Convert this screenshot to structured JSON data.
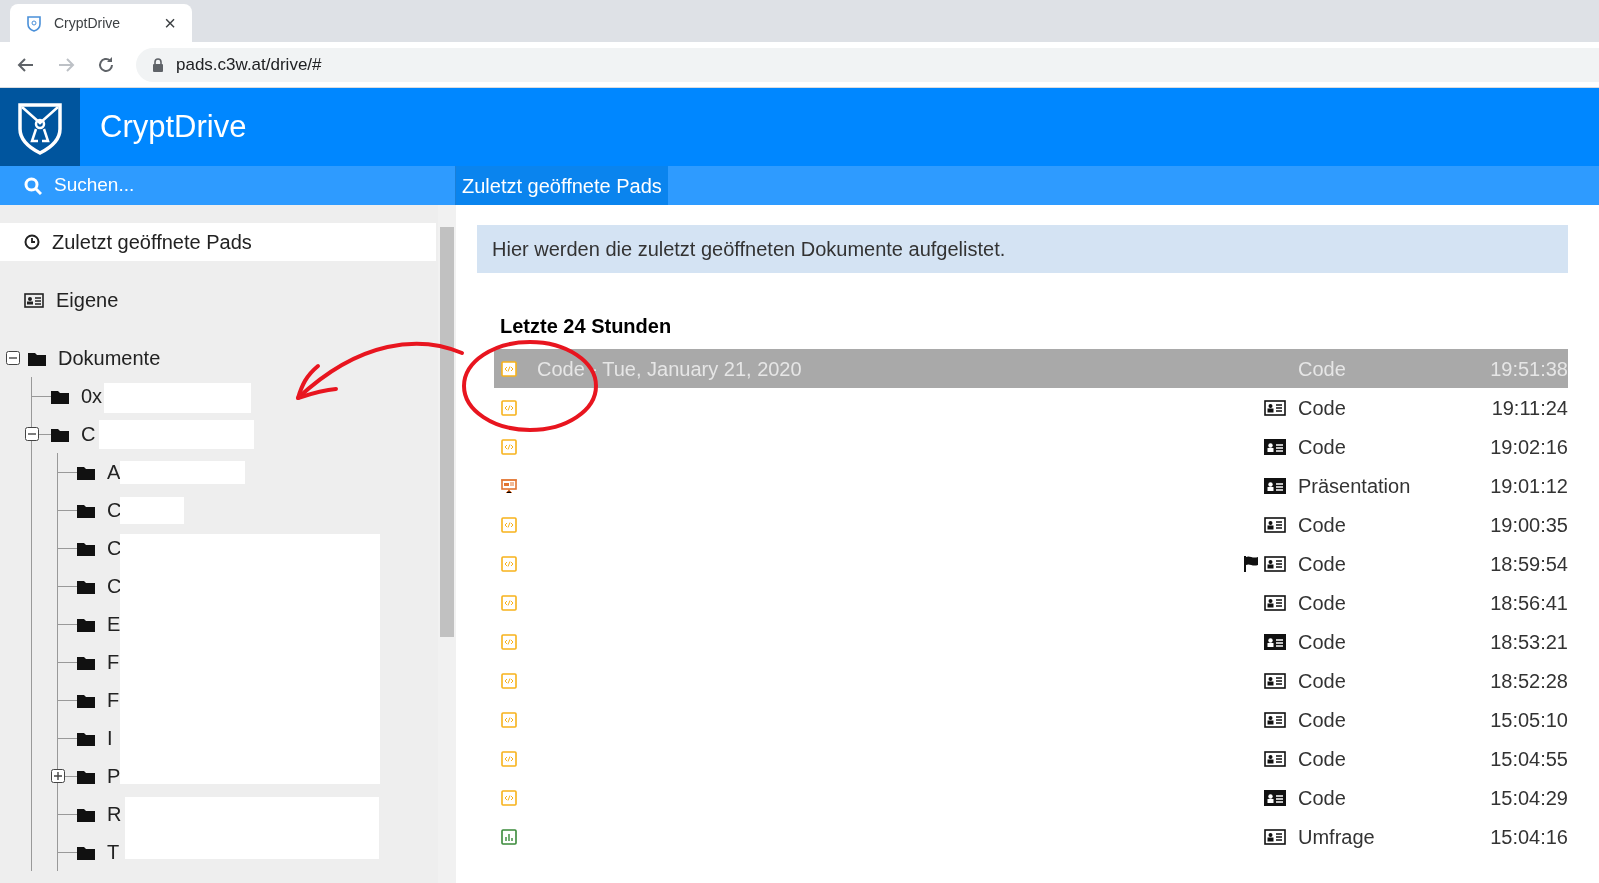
{
  "browser": {
    "tab_title": "CryptDrive",
    "tab_close": "×",
    "url": "pads.c3w.at/drive/#"
  },
  "app": {
    "title": "CryptDrive"
  },
  "search": {
    "placeholder": "Suchen..."
  },
  "view_tab": {
    "label": "Zuletzt geöffnete Pads",
    "selected": true
  },
  "sidebar": {
    "items": [
      {
        "label": "Zuletzt geöffnete Pads",
        "kind": "recent",
        "selected": true
      },
      {
        "label": "Eigene",
        "kind": "owned",
        "selected": false
      }
    ],
    "tree": {
      "name": "Dokumente",
      "expanded": true,
      "children": [
        {
          "name": "0x"
        },
        {
          "name": "C",
          "expanded": true,
          "children": [
            {
              "name": "A"
            },
            {
              "name": "C"
            },
            {
              "name": "C"
            },
            {
              "name": "C"
            },
            {
              "name": "E"
            },
            {
              "name": "F"
            },
            {
              "name": "F"
            },
            {
              "name": "I"
            },
            {
              "name": "P",
              "expanded": false
            },
            {
              "name": "R"
            },
            {
              "name": "T"
            }
          ]
        }
      ]
    }
  },
  "info": "Hier werden die zuletzt geöffneten Dokumente aufgelistet.",
  "section_title": "Letzte 24 Stunden",
  "rows": [
    {
      "kind": "code",
      "title": "Code - Tue, January 21, 2020",
      "type": "Code",
      "time": "19:51:38",
      "selected": true
    },
    {
      "kind": "code",
      "card_filled": false,
      "type": "Code",
      "time": "19:11:24",
      "selected": false
    },
    {
      "kind": "code",
      "card_filled": true,
      "type": "Code",
      "time": "19:02:16",
      "selected": false
    },
    {
      "kind": "slide",
      "card_filled": true,
      "type": "Präsentation",
      "time": "19:01:12",
      "selected": false
    },
    {
      "kind": "code",
      "card_filled": false,
      "type": "Code",
      "time": "19:00:35",
      "selected": false
    },
    {
      "kind": "code",
      "card_filled": false,
      "flagged": true,
      "type": "Code",
      "time": "18:59:54",
      "selected": false
    },
    {
      "kind": "code",
      "card_filled": false,
      "type": "Code",
      "time": "18:56:41",
      "selected": false
    },
    {
      "kind": "code",
      "card_filled": true,
      "type": "Code",
      "time": "18:53:21",
      "selected": false
    },
    {
      "kind": "code",
      "card_filled": false,
      "type": "Code",
      "time": "18:52:28",
      "selected": false
    },
    {
      "kind": "code",
      "card_filled": false,
      "type": "Code",
      "time": "15:05:10",
      "selected": false
    },
    {
      "kind": "code",
      "card_filled": false,
      "type": "Code",
      "time": "15:04:55",
      "selected": false
    },
    {
      "kind": "code",
      "card_filled": true,
      "type": "Code",
      "time": "15:04:29",
      "selected": false
    },
    {
      "kind": "poll",
      "card_filled": false,
      "type": "Umfrage",
      "time": "15:04:16",
      "selected": false
    }
  ]
}
